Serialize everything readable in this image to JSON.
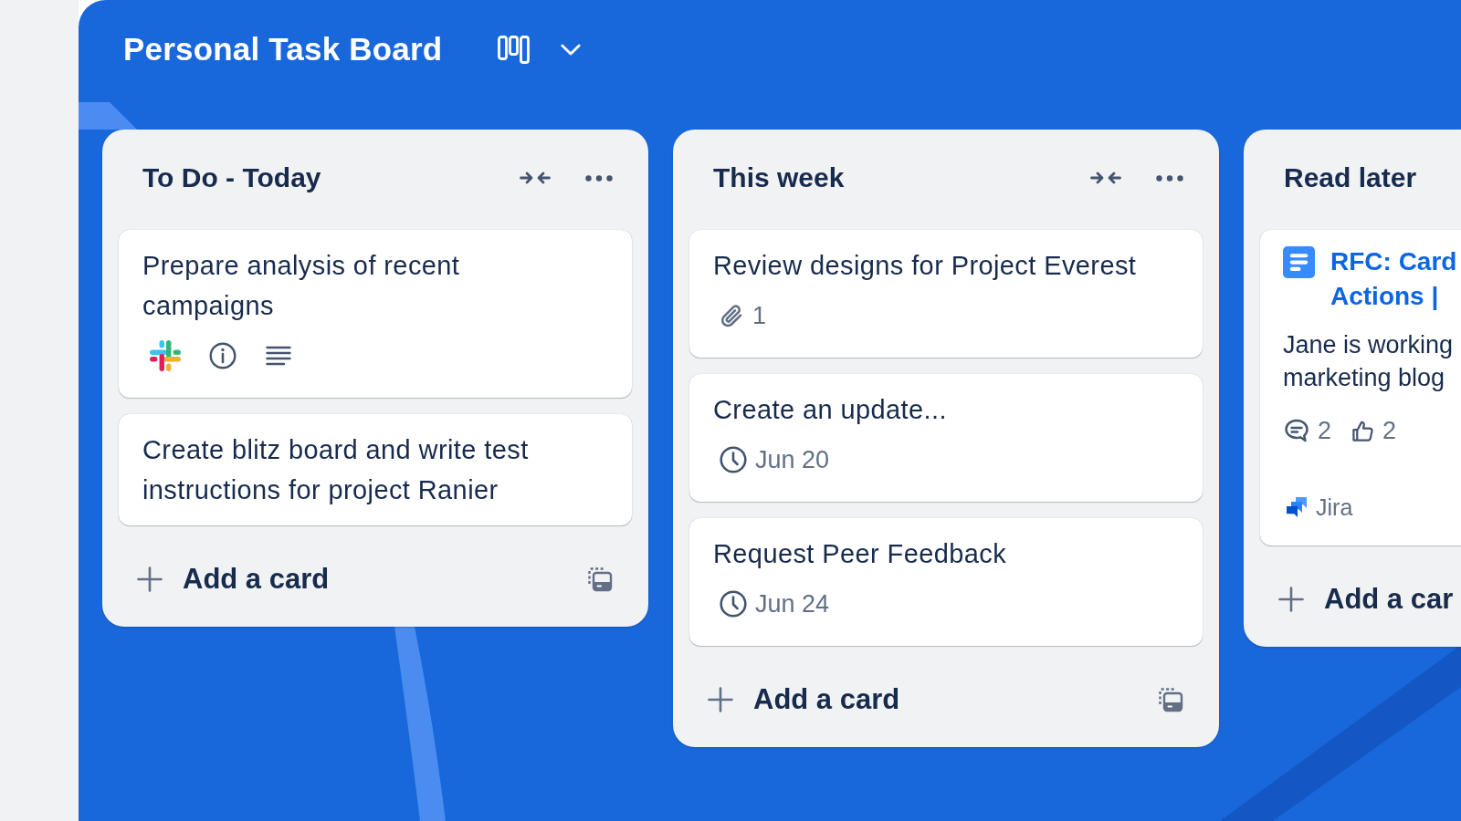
{
  "board": {
    "title": "Personal Task Board"
  },
  "columns": [
    {
      "title": "To Do - Today",
      "cut_off": false,
      "cards": [
        {
          "kind": "task",
          "title": "Prepare analysis of recent campaigns",
          "badges": [
            {
              "kind": "slack"
            },
            {
              "kind": "info"
            },
            {
              "kind": "description"
            }
          ]
        },
        {
          "kind": "task",
          "title": "Create blitz board and write test instructions for project Ranier"
        }
      ],
      "add_card": "Add a card"
    },
    {
      "title": "This week",
      "cut_off": false,
      "cards": [
        {
          "kind": "task",
          "title": "Review designs for Project Everest",
          "badges": [
            {
              "kind": "attachment",
              "text": "1"
            }
          ]
        },
        {
          "kind": "task",
          "title": "Create an update...",
          "badges": [
            {
              "kind": "due",
              "text": "Jun 20"
            }
          ]
        },
        {
          "kind": "task",
          "title": "Request Peer Feedback",
          "badges": [
            {
              "kind": "due",
              "text": "Jun 24"
            }
          ]
        }
      ],
      "add_card": "Add a card"
    },
    {
      "title": "Read later",
      "cut_off": true,
      "cards": [
        {
          "kind": "link",
          "title": "RFC: Card Actions |",
          "description": "Jane is working marketing blog",
          "badges": [
            {
              "kind": "comments",
              "text": "2"
            },
            {
              "kind": "likes",
              "text": "2"
            }
          ],
          "source": {
            "kind": "jira",
            "text": "Jira"
          }
        }
      ],
      "add_card": "Add a car"
    }
  ]
}
